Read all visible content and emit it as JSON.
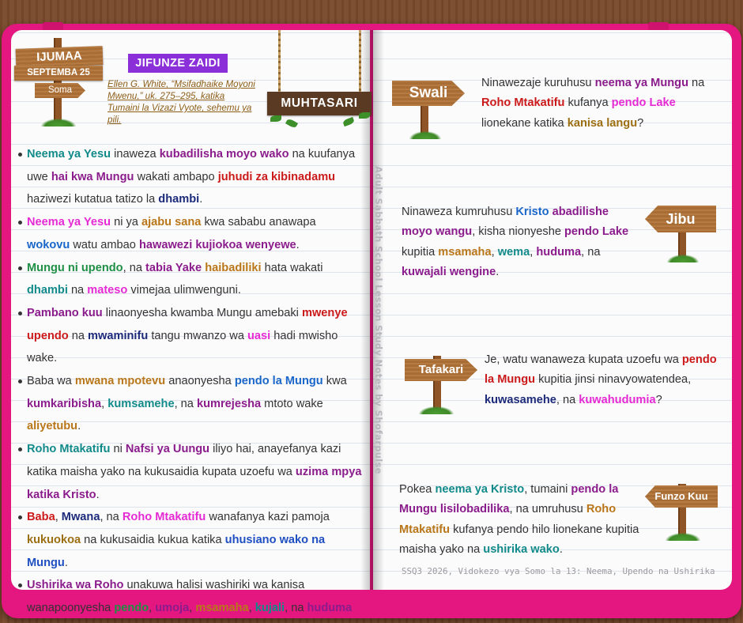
{
  "left": {
    "date_sign": {
      "day": "IJUMAA",
      "date": "SEPTEMBA 25",
      "arrow": "Soma"
    },
    "section_tag": "JIFUNZE ZAIDI",
    "reference": "Ellen G. White, “Msifadhaike Moyoni Mwenu,” uk. 275–295, katika Tumaini la Vizazi Vyote, sehemu ya pili.",
    "summary_sign": "MUHTASARI",
    "bullets": [
      [
        [
          "Neema ya Yesu",
          "teal"
        ],
        [
          " inaweza ",
          ""
        ],
        [
          "kubadilisha moyo wako",
          "purple"
        ],
        [
          " na kuufanya uwe ",
          ""
        ],
        [
          "hai kwa Mungu",
          "purple"
        ],
        [
          " wakati ambapo ",
          ""
        ],
        [
          "juhudi za kibinadamu",
          "red"
        ],
        [
          " haziwezi kutatua tatizo la ",
          ""
        ],
        [
          "dhambi",
          "navy"
        ],
        [
          ".",
          ""
        ]
      ],
      [
        [
          "Neema ya Yesu",
          "magenta"
        ],
        [
          " ni ya ",
          ""
        ],
        [
          "ajabu sana",
          "orange"
        ],
        [
          " kwa sababu anawapa ",
          ""
        ],
        [
          "wokovu",
          "blue"
        ],
        [
          " watu ambao ",
          ""
        ],
        [
          "hawawezi kujiokoa wenyewe",
          "purple"
        ],
        [
          ".",
          ""
        ]
      ],
      [
        [
          "Mungu ni upendo",
          "green"
        ],
        [
          ", na ",
          ""
        ],
        [
          "tabia Yake",
          "purple"
        ],
        [
          " ",
          ""
        ],
        [
          "haibadiliki",
          "orange"
        ],
        [
          " hata wakati ",
          ""
        ],
        [
          "dhambi",
          "teal"
        ],
        [
          " na ",
          ""
        ],
        [
          "mateso",
          "magenta"
        ],
        [
          " vimejaa ulimwenguni.",
          ""
        ]
      ],
      [
        [
          "Pambano kuu",
          "purple"
        ],
        [
          " linaonyesha kwamba Mungu amebaki ",
          ""
        ],
        [
          "mwenye upendo",
          "red"
        ],
        [
          " na ",
          ""
        ],
        [
          "mwaminifu",
          "navy"
        ],
        [
          " tangu mwanzo wa ",
          ""
        ],
        [
          "uasi",
          "magenta"
        ],
        [
          " hadi mwisho wake.",
          ""
        ]
      ],
      [
        [
          "Baba wa ",
          ""
        ],
        [
          "mwana mpotevu",
          "orange"
        ],
        [
          " anaonyesha ",
          ""
        ],
        [
          "pendo la Mungu",
          "blue"
        ],
        [
          " kwa ",
          ""
        ],
        [
          "kumkaribisha",
          "purple"
        ],
        [
          ", ",
          ""
        ],
        [
          "kumsamehe",
          "teal"
        ],
        [
          ", na ",
          ""
        ],
        [
          "kumrejesha",
          "purple"
        ],
        [
          " mtoto wake ",
          ""
        ],
        [
          "aliyetubu",
          "orange"
        ],
        [
          ".",
          ""
        ]
      ],
      [
        [
          "Roho Mtakatifu",
          "teal"
        ],
        [
          " ni ",
          ""
        ],
        [
          "Nafsi ya Uungu",
          "purple"
        ],
        [
          " iliyo hai, anayefanya kazi katika maisha yako na kukusaidia kupata uzoefu wa ",
          ""
        ],
        [
          "uzima mpya katika Kristo",
          "purple"
        ],
        [
          ".",
          ""
        ]
      ],
      [
        [
          "Baba",
          "red"
        ],
        [
          ", ",
          ""
        ],
        [
          "Mwana",
          "navy"
        ],
        [
          ", na ",
          ""
        ],
        [
          "Roho Mtakatifu",
          "magenta"
        ],
        [
          " wanafanya kazi pamoja ",
          ""
        ],
        [
          "kukuokoa",
          "olive"
        ],
        [
          " na kukusaidia kukua katika ",
          ""
        ],
        [
          "uhusiano wako na Mungu",
          "royal"
        ],
        [
          ".",
          ""
        ]
      ],
      [
        [
          "Ushirika wa Roho",
          "purple"
        ],
        [
          " unakuwa halisi washiriki wa kanisa wanapoonyesha ",
          ""
        ],
        [
          "pendo",
          "green"
        ],
        [
          ", ",
          ""
        ],
        [
          "umoja",
          "purple"
        ],
        [
          ", ",
          ""
        ],
        [
          "msamaha",
          "orange"
        ],
        [
          ", ",
          ""
        ],
        [
          "kujali",
          "teal"
        ],
        [
          ", na ",
          ""
        ],
        [
          "huduma isiyo na ubinafsi",
          "purple"
        ],
        [
          ".",
          ""
        ]
      ]
    ]
  },
  "spine_text": "Adult Sabbath School Lesson Study Notes by Shofarpulse",
  "right": {
    "swali": {
      "label": "Swali",
      "text": [
        [
          "Ninawezaje kuruhusu ",
          ""
        ],
        [
          "neema ya Mungu",
          "purple"
        ],
        [
          " na ",
          ""
        ],
        [
          "Roho Mtakatifu",
          "red"
        ],
        [
          " kufanya ",
          ""
        ],
        [
          "pendo Lake",
          "magenta"
        ],
        [
          " lionekane katika ",
          ""
        ],
        [
          "kanisa langu",
          "olive"
        ],
        [
          "?",
          ""
        ]
      ]
    },
    "jibu": {
      "label": "Jibu",
      "text": [
        [
          "Ninaweza kumruhusu ",
          ""
        ],
        [
          "Kristo",
          "blue"
        ],
        [
          " ",
          ""
        ],
        [
          "abadilishe moyo wangu",
          "purple"
        ],
        [
          ", kisha nionyeshe ",
          ""
        ],
        [
          "pendo Lake",
          "purple"
        ],
        [
          " kupitia ",
          ""
        ],
        [
          "msamaha",
          "orange"
        ],
        [
          ", ",
          ""
        ],
        [
          "wema",
          "teal"
        ],
        [
          ", ",
          ""
        ],
        [
          "huduma",
          "purple"
        ],
        [
          ", na ",
          ""
        ],
        [
          "kuwajali wengine",
          "purple"
        ],
        [
          ".",
          ""
        ]
      ]
    },
    "tafakari": {
      "label": "Tafakari",
      "text": [
        [
          "Je, watu wanaweza kupata uzoefu wa ",
          ""
        ],
        [
          "pendo la Mungu",
          "red"
        ],
        [
          " kupitia jinsi ninavyowatendea, ",
          ""
        ],
        [
          "kuwasamehe",
          "navy"
        ],
        [
          ", na ",
          ""
        ],
        [
          "kuwahudumia",
          "magenta"
        ],
        [
          "?",
          ""
        ]
      ]
    },
    "funzo": {
      "label": "Funzo Kuu",
      "text": [
        [
          "Pokea ",
          ""
        ],
        [
          "neema ya Kristo",
          "teal"
        ],
        [
          ", tumaini ",
          ""
        ],
        [
          "pendo la Mungu lisilobadilika",
          "purple"
        ],
        [
          ", na umruhusu ",
          ""
        ],
        [
          "Roho Mtakatifu",
          "orange"
        ],
        [
          " kufanya pendo hilo lionekane kupitia maisha yako na ",
          ""
        ],
        [
          "ushirika wako",
          "teal"
        ],
        [
          ".",
          ""
        ]
      ]
    },
    "footer": "SSQ3 2026, Vidokezo vya Somo la 13: Neema, Upendo na Ushirika"
  },
  "colors": {
    "cover": "#e4167f",
    "tag": "#8b2fd9",
    "teal": "#128a8a",
    "purple": "#8b1c8c",
    "red": "#cc1a1a",
    "navy": "#1d2b7a",
    "magenta": "#e52ad4",
    "orange": "#b9771a",
    "blue": "#1a66c9",
    "green": "#1f8f45"
  }
}
